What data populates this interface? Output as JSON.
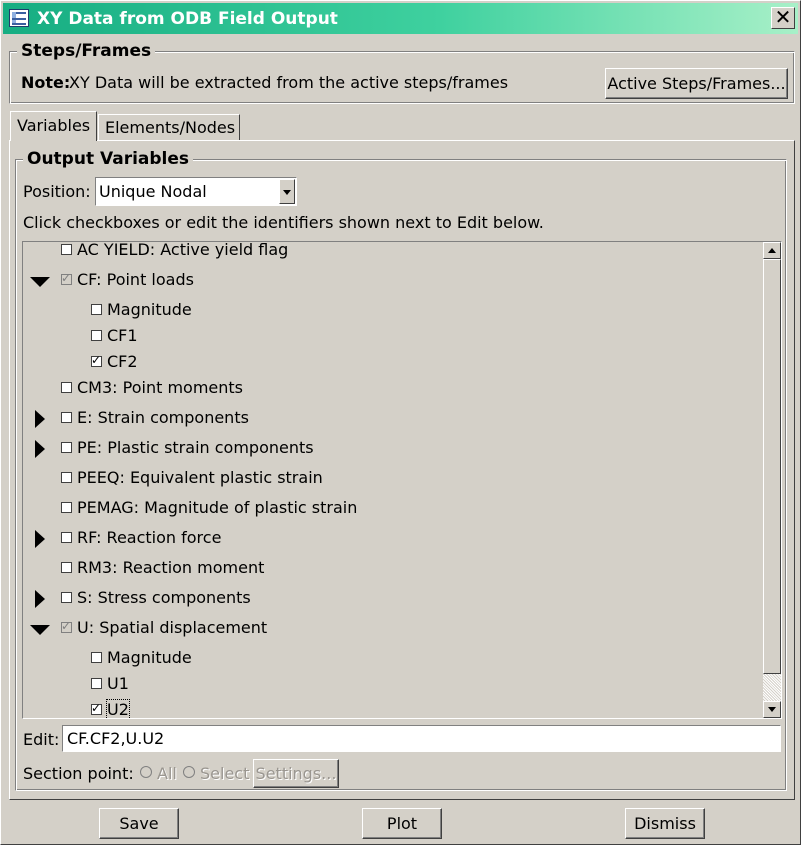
{
  "window": {
    "title": "XY Data from ODB Field Output",
    "close_glyph": "✕"
  },
  "steps_frames": {
    "group_title": "Steps/Frames",
    "note_label": "Note:",
    "note_text": "XY Data will be extracted from the active steps/frames",
    "active_button": "Active Steps/Frames..."
  },
  "tabs": [
    {
      "label": "Variables",
      "active": true
    },
    {
      "label": "Elements/Nodes",
      "active": false
    }
  ],
  "output_variables": {
    "group_title": "Output Variables",
    "position_label": "Position:",
    "position_value": "Unique Nodal",
    "instructions": "Click checkboxes or edit the identifiers shown next to Edit below.",
    "tree": [
      {
        "label": "AC YIELD: Active yield flag",
        "level": 0,
        "expander": "none",
        "checked": false,
        "disabled": false
      },
      {
        "label": "CF: Point loads",
        "level": 0,
        "expander": "expanded",
        "checked": true,
        "disabled": true
      },
      {
        "label": "Magnitude",
        "level": 1,
        "expander": "none",
        "checked": false,
        "disabled": false
      },
      {
        "label": "CF1",
        "level": 1,
        "expander": "none",
        "checked": false,
        "disabled": false
      },
      {
        "label": "CF2",
        "level": 1,
        "expander": "none",
        "checked": true,
        "disabled": false
      },
      {
        "label": "CM3: Point moments",
        "level": 0,
        "expander": "none",
        "checked": false,
        "disabled": false
      },
      {
        "label": "E: Strain components",
        "level": 0,
        "expander": "collapsed",
        "checked": false,
        "disabled": false
      },
      {
        "label": "PE: Plastic strain components",
        "level": 0,
        "expander": "collapsed",
        "checked": false,
        "disabled": false
      },
      {
        "label": "PEEQ: Equivalent plastic strain",
        "level": 0,
        "expander": "none",
        "checked": false,
        "disabled": false
      },
      {
        "label": "PEMAG: Magnitude of plastic strain",
        "level": 0,
        "expander": "none",
        "checked": false,
        "disabled": false
      },
      {
        "label": "RF: Reaction force",
        "level": 0,
        "expander": "collapsed",
        "checked": false,
        "disabled": false
      },
      {
        "label": "RM3: Reaction moment",
        "level": 0,
        "expander": "none",
        "checked": false,
        "disabled": false
      },
      {
        "label": "S: Stress components",
        "level": 0,
        "expander": "collapsed",
        "checked": false,
        "disabled": false
      },
      {
        "label": "U: Spatial displacement",
        "level": 0,
        "expander": "expanded",
        "checked": true,
        "disabled": true
      },
      {
        "label": "Magnitude",
        "level": 1,
        "expander": "none",
        "checked": false,
        "disabled": false
      },
      {
        "label": "U1",
        "level": 1,
        "expander": "none",
        "checked": false,
        "disabled": false
      },
      {
        "label": "U2",
        "level": 1,
        "expander": "none",
        "checked": true,
        "disabled": false,
        "focused": true
      }
    ],
    "edit_label": "Edit:",
    "edit_value": "CF.CF2,U.U2",
    "section_point_label": "Section point:",
    "radio_all": "All",
    "radio_select": "Select",
    "settings_button": "Settings..."
  },
  "footer": {
    "save": "Save",
    "plot": "Plot",
    "dismiss": "Dismiss"
  },
  "colors": {
    "titlebar_start": "#16ad82",
    "titlebar_end": "#a8f0c8",
    "face": "#d4d0c8"
  }
}
